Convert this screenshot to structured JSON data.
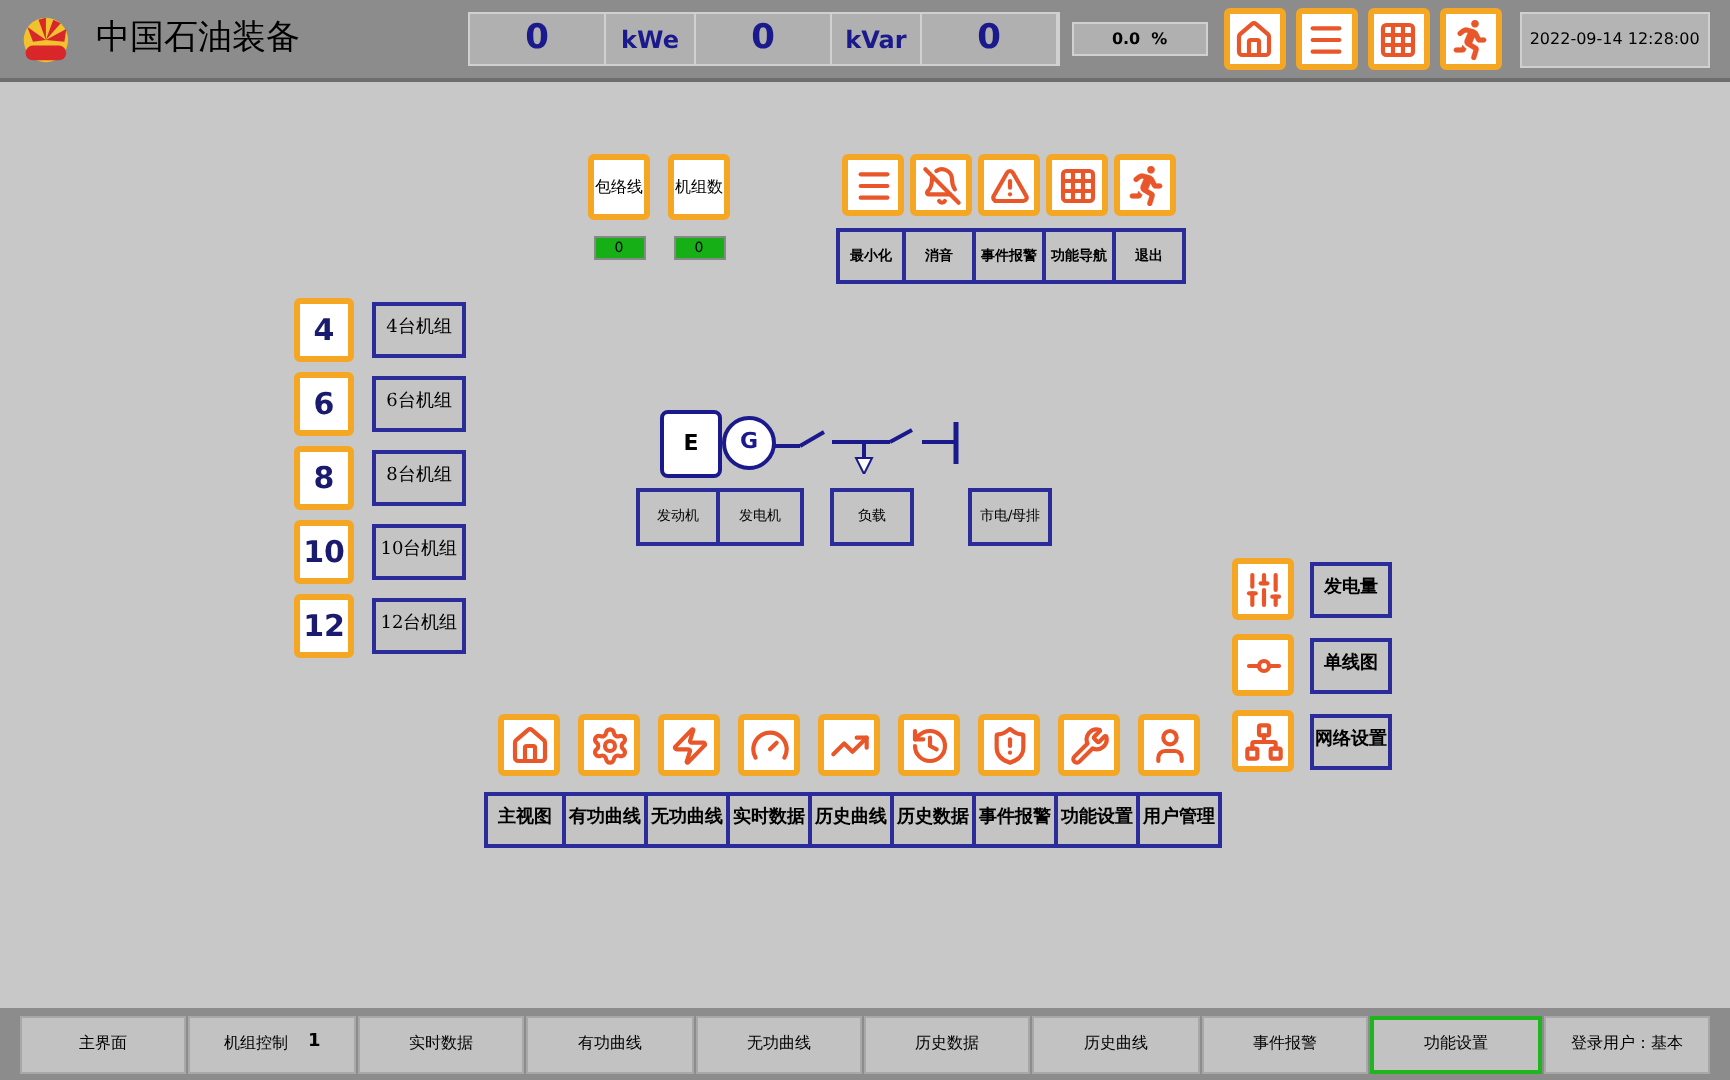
{
  "header": {
    "title": "中国石油装备",
    "readings": [
      {
        "value": "0",
        "unit": "kWe"
      },
      {
        "value": "0",
        "unit": "kVar"
      },
      {
        "value": "0"
      }
    ],
    "progress": {
      "text": "0.0  %"
    },
    "toolbar": [
      {
        "kind": "home"
      },
      {
        "kind": "menu"
      },
      {
        "kind": "grid"
      },
      {
        "kind": "exit"
      }
    ],
    "datetime": "2022-09-14 12:28:00"
  },
  "counters": [
    {
      "label": "包络线",
      "value": "0"
    },
    {
      "label": "机组数",
      "value": "0"
    }
  ],
  "top_menu": [
    {
      "kind": "menu",
      "label": "最小化"
    },
    {
      "kind": "mute",
      "label": "消音"
    },
    {
      "kind": "alarm",
      "label": "事件报警"
    },
    {
      "kind": "grid",
      "label": "功能导航"
    },
    {
      "kind": "exit",
      "label": "退出"
    }
  ],
  "unit_groups": [
    {
      "number": "4",
      "label": "4台机组"
    },
    {
      "number": "6",
      "label": "6台机组"
    },
    {
      "number": "8",
      "label": "8台机组"
    },
    {
      "number": "10",
      "label": "10台机组"
    },
    {
      "number": "12",
      "label": "12台机组"
    }
  ],
  "diagram": {
    "engine": "E",
    "generator": "G",
    "labels": [
      "发动机",
      "发电机",
      "负载",
      "市电/母排"
    ]
  },
  "side_menu": [
    {
      "kind": "sliders",
      "label": "发电量"
    },
    {
      "kind": "line",
      "label": "单线图"
    },
    {
      "kind": "network",
      "label": "网络设置"
    }
  ],
  "bottom_menu": [
    {
      "kind": "home",
      "label": "主视图"
    },
    {
      "kind": "gear",
      "label": "有功曲线"
    },
    {
      "kind": "zap",
      "label": "无功曲线"
    },
    {
      "kind": "gauge",
      "label": "实时数据"
    },
    {
      "kind": "trend",
      "label": "历史曲线"
    },
    {
      "kind": "history",
      "label": "历史数据"
    },
    {
      "kind": "shield",
      "label": "事件报警"
    },
    {
      "kind": "tools",
      "label": "功能设置"
    },
    {
      "kind": "user",
      "label": "用户管理"
    }
  ],
  "footer_tabs": [
    {
      "label": "主界面",
      "selected": false
    },
    {
      "label": "机组控制",
      "value": "1",
      "selected": false
    },
    {
      "label": "实时数据",
      "selected": false
    },
    {
      "label": "有功曲线",
      "selected": false
    },
    {
      "label": "无功曲线",
      "selected": false
    },
    {
      "label": "历史数据",
      "selected": false
    },
    {
      "label": "历史曲线",
      "selected": false
    },
    {
      "label": "事件报警",
      "selected": false
    },
    {
      "label": "功能设置",
      "selected": true
    },
    {
      "label": "登录用户：基本",
      "selected": false
    }
  ]
}
